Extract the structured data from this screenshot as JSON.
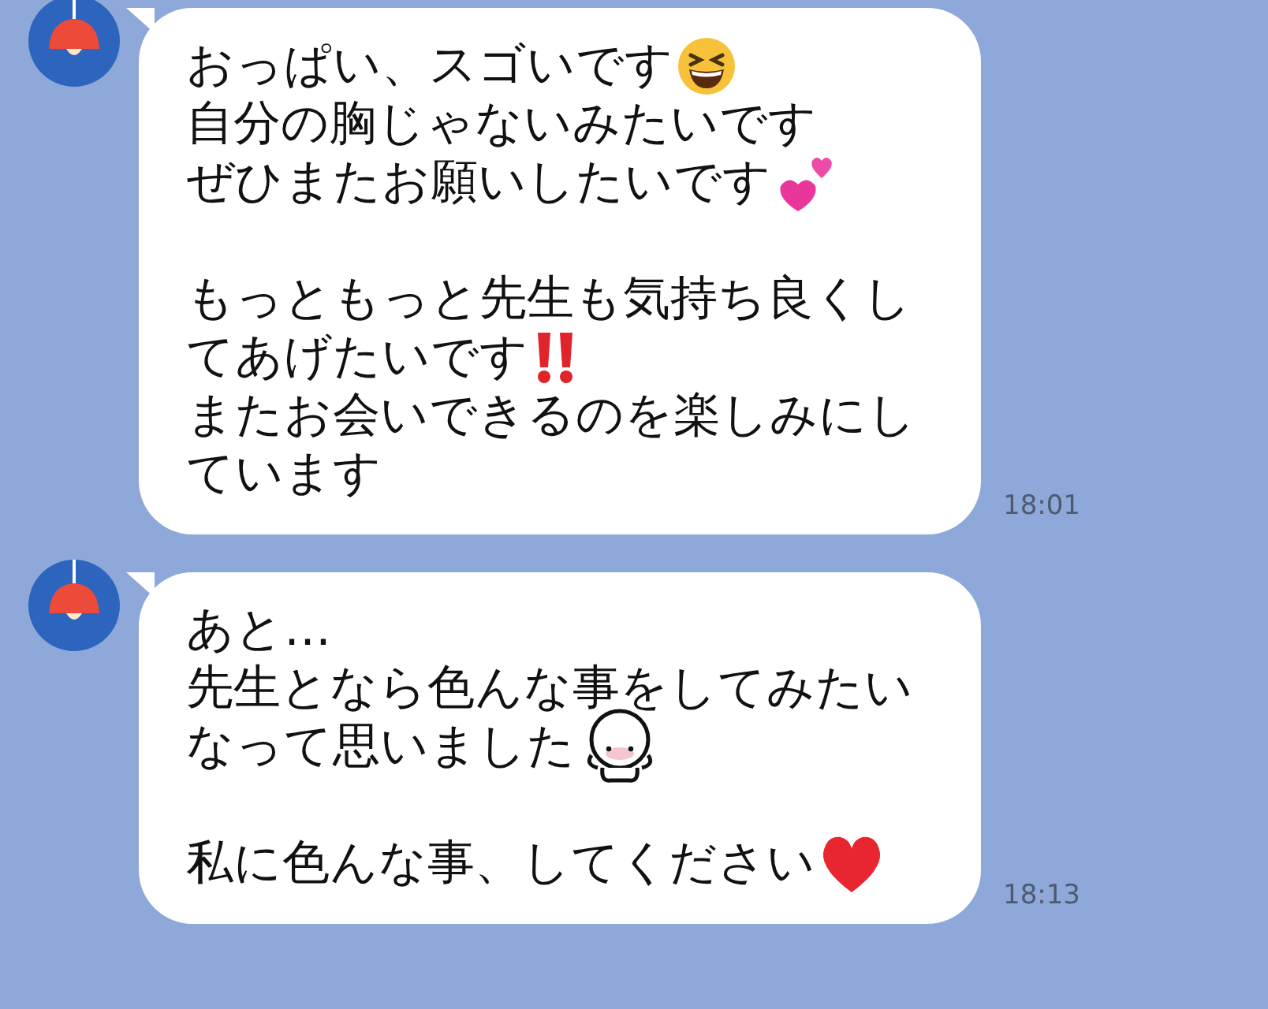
{
  "messages": [
    {
      "time": "18:01",
      "paragraphs": [
        [
          [
            {
              "kind": "text",
              "text": "おっぱい、スゴいです"
            },
            {
              "kind": "grin"
            }
          ],
          [
            {
              "kind": "text",
              "text": "自分の胸じゃないみたいです"
            }
          ],
          [
            {
              "kind": "text",
              "text": "ぜひまたお願いしたいです"
            },
            {
              "kind": "hearts"
            }
          ]
        ],
        [
          [
            {
              "kind": "text",
              "text": "もっともっと先生も気持ち良くし"
            }
          ],
          [
            {
              "kind": "text",
              "text": "てあげたいです"
            },
            {
              "kind": "bang"
            }
          ],
          [
            {
              "kind": "text",
              "text": "またお会いできるのを楽しみにし"
            }
          ],
          [
            {
              "kind": "text",
              "text": "ています"
            }
          ]
        ]
      ]
    },
    {
      "time": "18:13",
      "paragraphs": [
        [
          [
            {
              "kind": "text",
              "text": "あと…"
            }
          ],
          [
            {
              "kind": "text",
              "text": "先生となら色んな事をしてみたい"
            }
          ],
          [
            {
              "kind": "text",
              "text": "なって思いました"
            },
            {
              "kind": "blob"
            }
          ]
        ],
        [
          [
            {
              "kind": "text",
              "text": "私に色んな事、してください"
            },
            {
              "kind": "heart"
            }
          ]
        ]
      ]
    }
  ]
}
